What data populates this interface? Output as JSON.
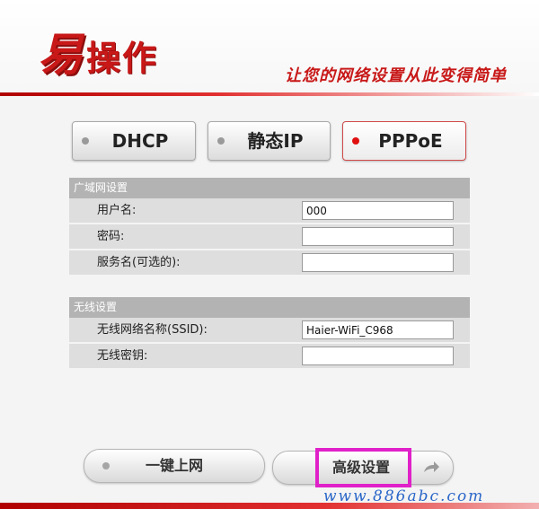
{
  "header": {
    "logo_main": "易",
    "logo_sub": "操作",
    "slogan": "让您的网络设置从此变得简单"
  },
  "modes": [
    {
      "label": "DHCP",
      "active": false
    },
    {
      "label": "静态IP",
      "active": false
    },
    {
      "label": "PPPoE",
      "active": true
    }
  ],
  "wan": {
    "title": "广域网设置",
    "fields": [
      {
        "label": "用户名:",
        "value": "000"
      },
      {
        "label": "密码:",
        "value": ""
      },
      {
        "label": "服务名(可选的):",
        "value": ""
      }
    ]
  },
  "wireless": {
    "title": "无线设置",
    "fields": [
      {
        "label": "无线网络名称(SSID):",
        "value": "Haier-WiFi_C968"
      },
      {
        "label": "无线密钥:",
        "value": ""
      }
    ]
  },
  "buttons": {
    "oneclick": "一键上网",
    "advanced": "高级设置"
  },
  "watermark": "www.886abc.com",
  "colors": {
    "brand_red": "#c81818",
    "active_dot": "#e01010",
    "highlight": "#e020c8",
    "panel_header": "#b3b3b3"
  }
}
